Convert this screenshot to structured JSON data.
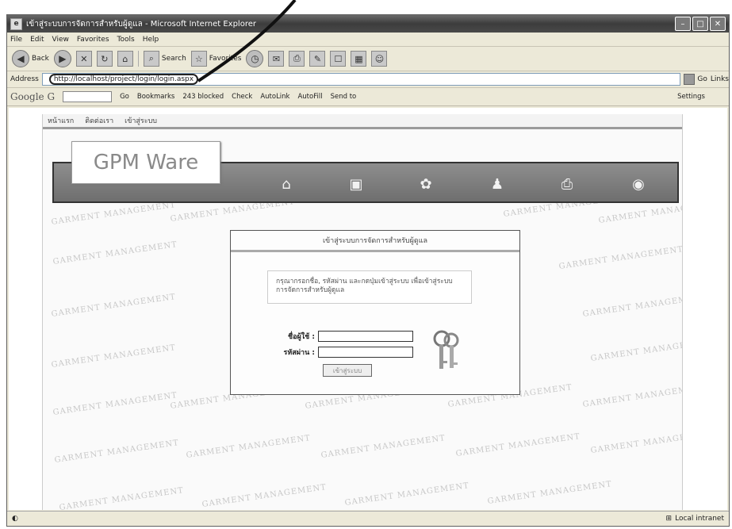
{
  "window": {
    "title": "เข้าสู่ระบบการจัดการสำหรับผู้ดูแล - Microsoft Internet Explorer"
  },
  "menu": [
    "File",
    "Edit",
    "View",
    "Favorites",
    "Tools",
    "Help"
  ],
  "toolbar": {
    "back_label": "Back",
    "search_label": "Search",
    "favorites_label": "Favorites"
  },
  "address": {
    "label": "Address",
    "url": "http://localhost/project/login/login.aspx",
    "go_label": "Go",
    "links_label": "Links"
  },
  "google_bar": {
    "logo": "Google G",
    "go_label": "Go",
    "bookmarks_label": "Bookmarks",
    "blocked_label": "243 blocked",
    "check_label": "Check",
    "autolink_label": "AutoLink",
    "autofill_label": "AutoFill",
    "send_label": "Send to",
    "settings_label": "Settings"
  },
  "page": {
    "nav": [
      "หน้าแรก",
      "ติดต่อเรา",
      "เข้าสู่ระบบ"
    ],
    "logo": "GPM Ware",
    "watermark": "GARMENT MANAGEMENT",
    "login": {
      "header": "เข้าสู่ระบบการจัดการสำหรับผู้ดูแล",
      "message": "กรุณากรอกชื่อ, รหัสผ่าน และกดปุ่มเข้าสู่ระบบ เพื่อเข้าสู่ระบบการจัดการสำหรับผู้ดูแล",
      "username_label": "ชื่อผู้ใช้ :",
      "password_label": "รหัสผ่าน :",
      "button_label": "เข้าสู่ระบบ"
    }
  },
  "status": {
    "zone": "Local intranet"
  }
}
